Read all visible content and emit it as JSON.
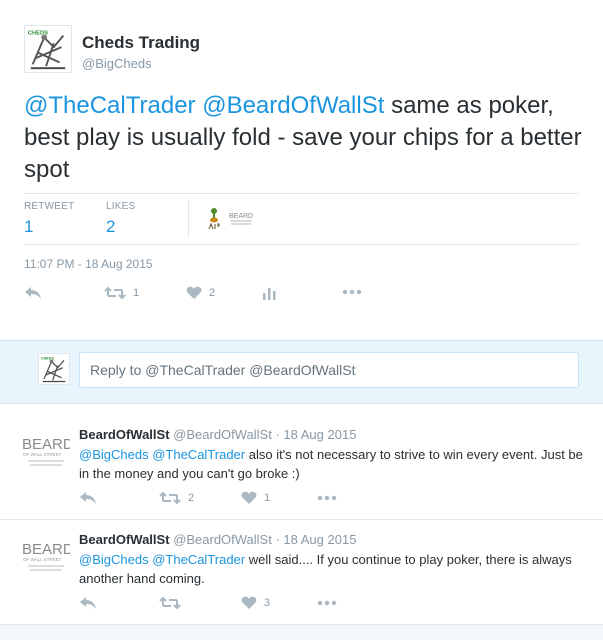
{
  "tweet": {
    "display_name": "Cheds Trading",
    "screen_name": "@BigCheds",
    "mention_1": "@TheCalTrader",
    "mention_2": "@BeardOfWallSt",
    "text": " same as poker, best play is usually fold - save your chips for a better spot",
    "stats": {
      "retweet_label": "RETWEET",
      "retweet_count": "1",
      "likes_label": "LIKES",
      "likes_count": "2"
    },
    "liker_avatar_text": "BEARD",
    "timestamp": "11:07 PM - 18 Aug 2015",
    "actions": {
      "reply_icon": "reply-icon",
      "retweet_icon": "retweet-icon",
      "retweet_count": "1",
      "like_icon": "heart-icon",
      "like_count": "2",
      "analytics_icon": "analytics-icon",
      "more_icon": "more-icon"
    }
  },
  "reply_box": {
    "placeholder": "Reply to @TheCalTrader @BeardOfWallSt"
  },
  "avatar": {
    "logo_text": "CHEDS"
  },
  "replies": [
    {
      "name": "BeardOfWallSt",
      "screen_name": "@BeardOfWallSt",
      "date": "· 18 Aug 2015",
      "avatar_text": "BEARD",
      "avatar_subtext": "OF WALL STREET",
      "mention_1": "@BigCheds",
      "mention_2": "@TheCalTrader",
      "text": " also it's not necessary to strive to win every event. Just be in the money and you can't go broke :)",
      "retweet_count": "2",
      "like_count": "1"
    },
    {
      "name": "BeardOfWallSt",
      "screen_name": "@BeardOfWallSt",
      "date": "· 18 Aug 2015",
      "avatar_text": "BEARD",
      "avatar_subtext": "OF WALL STREET",
      "mention_1": "@BigCheds",
      "mention_2": "@TheCalTrader",
      "text": " well said.... If you continue to play poker, there is always another hand coming.",
      "retweet_count": "",
      "like_count": "3"
    }
  ],
  "colors": {
    "link": "#1b95e0",
    "icon": "#aab8c2",
    "reply_box_bg": "#e8f5fd"
  }
}
